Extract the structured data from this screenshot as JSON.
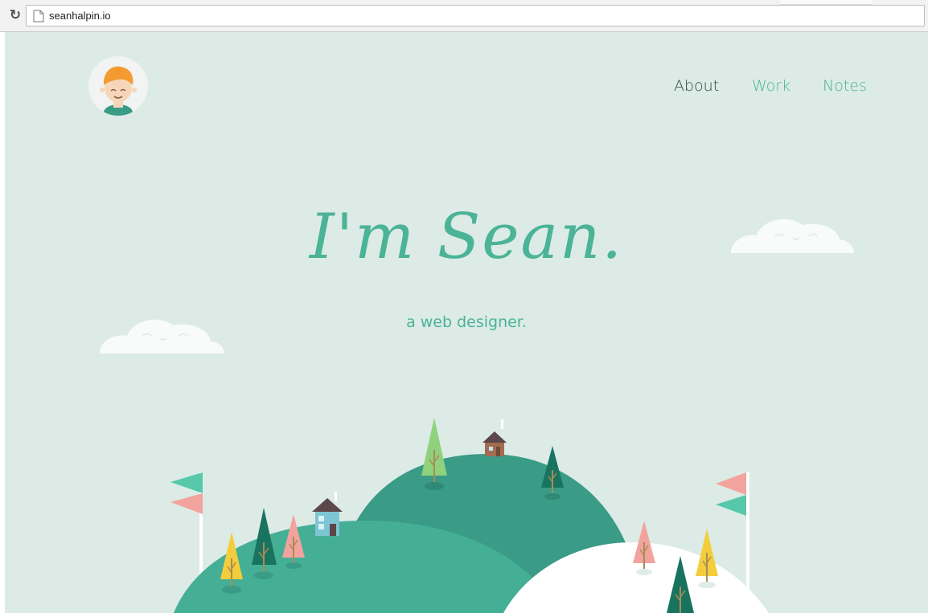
{
  "browser": {
    "url": "seanhalpin.io",
    "reload_icon": "reload-icon",
    "page_icon": "page-icon"
  },
  "site": {
    "avatar_icon": "avatar-icon",
    "nav": {
      "about": "About",
      "work": "Work",
      "notes": "Notes"
    },
    "hero": {
      "title": "I'm Sean.",
      "subtitle": "a web designer."
    }
  },
  "colors": {
    "background": "#dcebe6",
    "accent": "#4bb396",
    "nav_active": "#2f4a45",
    "hill_dark": "#3a9b86",
    "hill_light": "#45af95",
    "cloud": "#f8fbfa",
    "flag_pink": "#f3a39d",
    "flag_teal": "#57c9aa"
  }
}
